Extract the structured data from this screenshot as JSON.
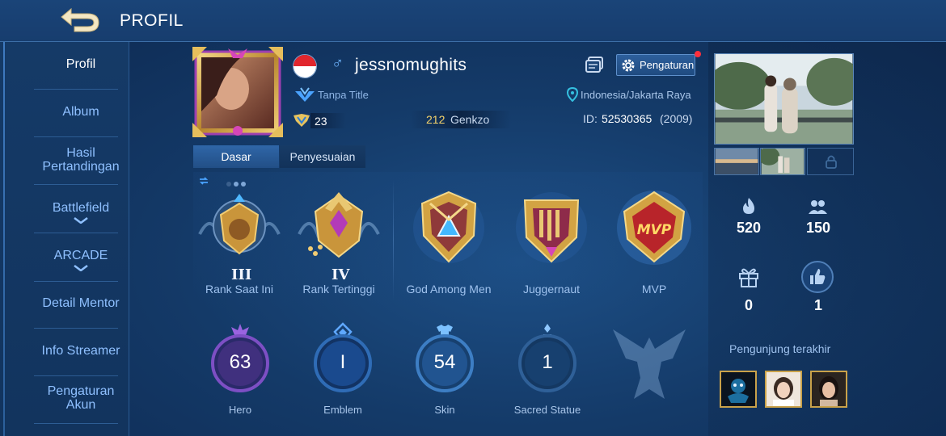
{
  "header": {
    "title": "PROFIL",
    "back_icon": "back-arrow-icon"
  },
  "sidebar": {
    "items": [
      {
        "label": "Profil",
        "active": true
      },
      {
        "label": "Album"
      },
      {
        "label": "Hasil Pertandingan"
      },
      {
        "label": "Battlefield",
        "expandable": true
      },
      {
        "label": "ARCADE",
        "expandable": true
      },
      {
        "label": "Detail Mentor"
      },
      {
        "label": "Info Streamer"
      },
      {
        "label": "Pengaturan Akun"
      }
    ]
  },
  "profile": {
    "username": "jessnomughits",
    "gender_symbol": "♂",
    "country_flag": "indonesia",
    "title": "Tanpa Title",
    "level": "23",
    "genkzo_value": "212",
    "genkzo_label": "Genkzo",
    "location": "Indonesia/Jakarta Raya",
    "id_label": "ID:",
    "id_value": "52530365",
    "id_year": "(2009)",
    "settings_label": "Pengaturan"
  },
  "tabs": [
    {
      "label": "Dasar",
      "active": true
    },
    {
      "label": "Penyesuaian"
    }
  ],
  "badges": [
    {
      "label": "Rank Saat Ini",
      "roman": "III"
    },
    {
      "label": "Rank Tertinggi",
      "roman": "IV"
    },
    {
      "label": "God Among Men"
    },
    {
      "label": "Juggernaut"
    },
    {
      "label": "MVP",
      "emblem_text": "MVP"
    }
  ],
  "stats": [
    {
      "label": "Hero",
      "value": "63"
    },
    {
      "label": "Emblem",
      "value": "I"
    },
    {
      "label": "Skin",
      "value": "54"
    },
    {
      "label": "Sacred Statue",
      "value": "1"
    }
  ],
  "social": {
    "popularity": "520",
    "followers": "150",
    "gifts": "0",
    "likes": "1"
  },
  "visitors_title": "Pengunjung terakhir",
  "colors": {
    "accent": "#8fc0ff",
    "gold": "#f5d36b",
    "notif": "#ff2f3c"
  }
}
